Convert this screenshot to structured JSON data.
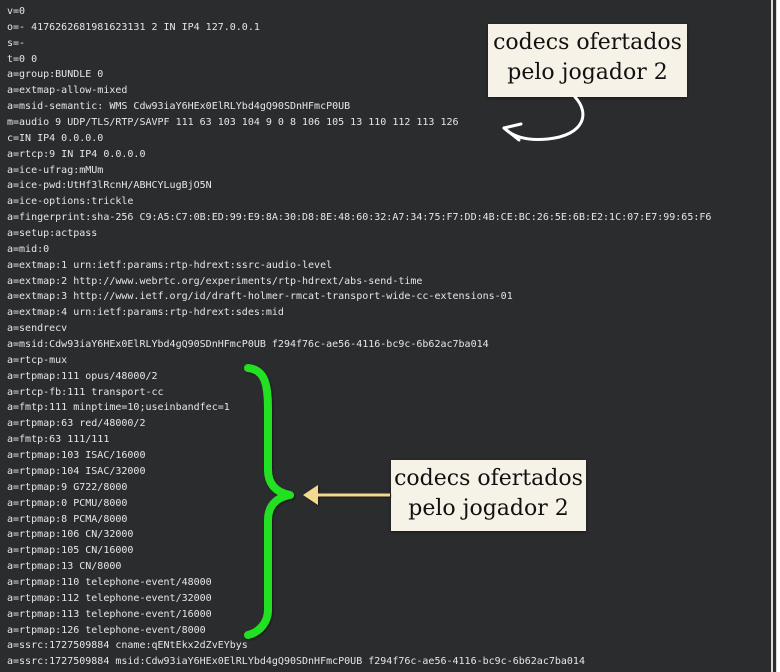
{
  "sdp_lines": [
    "v=0",
    "o=- 4176262681981623131 2 IN IP4 127.0.0.1",
    "s=-",
    "t=0 0",
    "a=group:BUNDLE 0",
    "a=extmap-allow-mixed",
    "a=msid-semantic: WMS Cdw93iaY6HEx0ElRLYbd4gQ90SDnHFmcP0UB",
    "m=audio 9 UDP/TLS/RTP/SAVPF 111 63 103 104 9 0 8 106 105 13 110 112 113 126",
    "c=IN IP4 0.0.0.0",
    "a=rtcp:9 IN IP4 0.0.0.0",
    "a=ice-ufrag:mMUm",
    "a=ice-pwd:UtHf3lRcnH/ABHCYLugBjO5N",
    "a=ice-options:trickle",
    "a=fingerprint:sha-256 C9:A5:C7:0B:ED:99:E9:8A:30:D8:8E:48:60:32:A7:34:75:F7:DD:4B:CE:BC:26:5E:6B:E2:1C:07:E7:99:65:F6",
    "a=setup:actpass",
    "a=mid:0",
    "a=extmap:1 urn:ietf:params:rtp-hdrext:ssrc-audio-level",
    "a=extmap:2 http://www.webrtc.org/experiments/rtp-hdrext/abs-send-time",
    "a=extmap:3 http://www.ietf.org/id/draft-holmer-rmcat-transport-wide-cc-extensions-01",
    "a=extmap:4 urn:ietf:params:rtp-hdrext:sdes:mid",
    "a=sendrecv",
    "a=msid:Cdw93iaY6HEx0ElRLYbd4gQ90SDnHFmcP0UB f294f76c-ae56-4116-bc9c-6b62ac7ba014",
    "a=rtcp-mux",
    "a=rtpmap:111 opus/48000/2",
    "a=rtcp-fb:111 transport-cc",
    "a=fmtp:111 minptime=10;useinbandfec=1",
    "a=rtpmap:63 red/48000/2",
    "a=fmtp:63 111/111",
    "a=rtpmap:103 ISAC/16000",
    "a=rtpmap:104 ISAC/32000",
    "a=rtpmap:9 G722/8000",
    "a=rtpmap:0 PCMU/8000",
    "a=rtpmap:8 PCMA/8000",
    "a=rtpmap:106 CN/32000",
    "a=rtpmap:105 CN/16000",
    "a=rtpmap:13 CN/8000",
    "a=rtpmap:110 telephone-event/48000",
    "a=rtpmap:112 telephone-event/32000",
    "a=rtpmap:113 telephone-event/16000",
    "a=rtpmap:126 telephone-event/8000",
    "a=ssrc:1727509884 cname:qENtEkx2dZvEYbys",
    "a=ssrc:1727509884 msid:Cdw93iaY6HEx0ElRLYbd4gQ90SDnHFmcP0UB f294f76c-ae56-4116-bc9c-6b62ac7ba014"
  ],
  "annotations": {
    "top_callout": {
      "line1": "codecs ofertados",
      "line2": "pelo jogador 2"
    },
    "bottom_callout": {
      "line1": "codecs ofertados",
      "line2": "pelo jogador 2"
    }
  },
  "colors": {
    "terminal_background": "#2b2c2e",
    "terminal_text": "#e6e6e6",
    "callout_background": "#f7f2e7",
    "brace_green": "#22e022",
    "arrow_yellow": "#f3d98d",
    "curved_arrow": "#ffffff"
  },
  "icons": {
    "curved_arrow": "curved-arrow-icon",
    "brace": "green-curly-brace-icon",
    "left_arrow": "yellow-left-arrow-icon"
  }
}
